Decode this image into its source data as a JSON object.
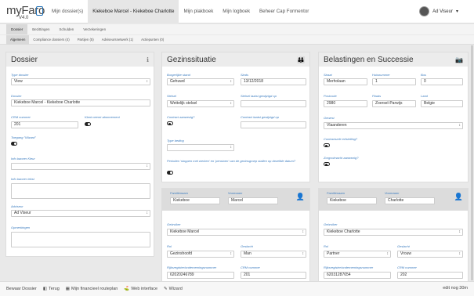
{
  "app": {
    "logo": "myFaro",
    "version": "V4.0"
  },
  "nav": [
    "Mijn dossier(s)",
    "Kiekeboe Marcel - Kiekeboe Charlotte",
    "Mijn plakboek",
    "Mijn logboek",
    "Beheer Cap Formentor"
  ],
  "user": {
    "name": "Ad Viseur"
  },
  "tabs1": [
    "Dossier",
    "Bezittingen",
    "Schulden",
    "Verzekeringen"
  ],
  "tabs2": [
    "Algemeen",
    "Compliance dossiers (4)",
    "Partijen (5)",
    "Adviseursnetwerk (1)",
    "Actiepunten (0)"
  ],
  "dossier": {
    "title": "Dossier",
    "type_label": "Type dossier",
    "type_value": "View",
    "dossier_label": "Dossier",
    "dossier_value": "Kiekeboe Marcel - Kiekeboe Charlotte",
    "crm_label": "CRM nummer",
    "crm_value": "201",
    "klant_label": "Klant neemt abonnement",
    "toegang_label": "Toegang \"Wizard\"",
    "banner_kleur_label": "Info banner Kleur",
    "banner_tekst_label": "Info banner tekst",
    "adviseur_label": "Adviseur",
    "adviseur_value": "Ad Viseur",
    "opmerkingen_label": "Opmerkingen"
  },
  "gezin": {
    "title": "Gezinssituatie",
    "burg_label": "Burgerlijke stand",
    "burg_value": "Gehuwd",
    "sinds_label": "Sinds",
    "sinds_value": "13/12/2018",
    "stelsel_label": "Stelsel",
    "stelsel_value": "Wettelijk stelsel",
    "stelsel_date_label": "Stelsel laatst gewijzigd op",
    "contract_label": "Contract aanwezig?",
    "contract_date_label": "Contract laatst gewijzigd op",
    "type_beding_label": "Type beding",
    "perioden_label": "Perioden 'stoppen met werken' en 'pensioen' van de gezinsgroep stallen op dezelfde datum?"
  },
  "belasting": {
    "title": "Belastingen en Successie",
    "straat_label": "Straat",
    "straat_value": "Merholaan",
    "huis_label": "Huisnummer",
    "huis_value": "1",
    "bus_label": "Bus",
    "bus_value": "0",
    "post_label": "Postcode",
    "post_value": "2980",
    "plaats_label": "Plaats",
    "plaats_value": "Zoersel-Parwijs",
    "land_label": "Land",
    "land_value": "Belgie",
    "gewest_label": "Gewest",
    "gewest_value": "Vlaanderen",
    "ctr_erf_label": "Contractuele erfstelling?",
    "zorg_label": "Zorgvolmacht aanwezig?"
  },
  "marcel": {
    "fam_label": "Familienaam",
    "fam_value": "Kiekeboe",
    "voor_label": "Voornaam",
    "voor_value": "Marcel",
    "gebr_label": "Gebruiker",
    "gebr_value": "Kiekeboe Marcel",
    "rol_label": "Rol",
    "rol_value": "Gezinshoofd",
    "gesl_label": "Geslacht",
    "gesl_value": "Man",
    "rijks_label": "Rijksregister/ondernemingsnummer",
    "rijks_value": "62020246789",
    "crm_label": "CRM nummer",
    "crm_value": "201"
  },
  "charlotte": {
    "fam_label": "Familienaam",
    "fam_value": "Kiekeboe",
    "voor_label": "Voornaam",
    "voor_value": "Charlotte",
    "gebr_label": "Gebruiker",
    "gebr_value": "Kiekeboe Charlotte",
    "rol_label": "Rol",
    "rol_value": "Partner",
    "gesl_label": "Geslacht",
    "gesl_value": "Vrouw",
    "rijks_label": "Rijksregister/ondernemingsnummer",
    "rijks_value": "62031287654",
    "crm_label": "CRM nummer",
    "crm_value": "202"
  },
  "bottom": {
    "items": [
      "Bewaar Dossier",
      "Terug",
      "Mijn financieel routeplan",
      "Web interface",
      "Wizard"
    ],
    "right": "edit nog 30m"
  }
}
